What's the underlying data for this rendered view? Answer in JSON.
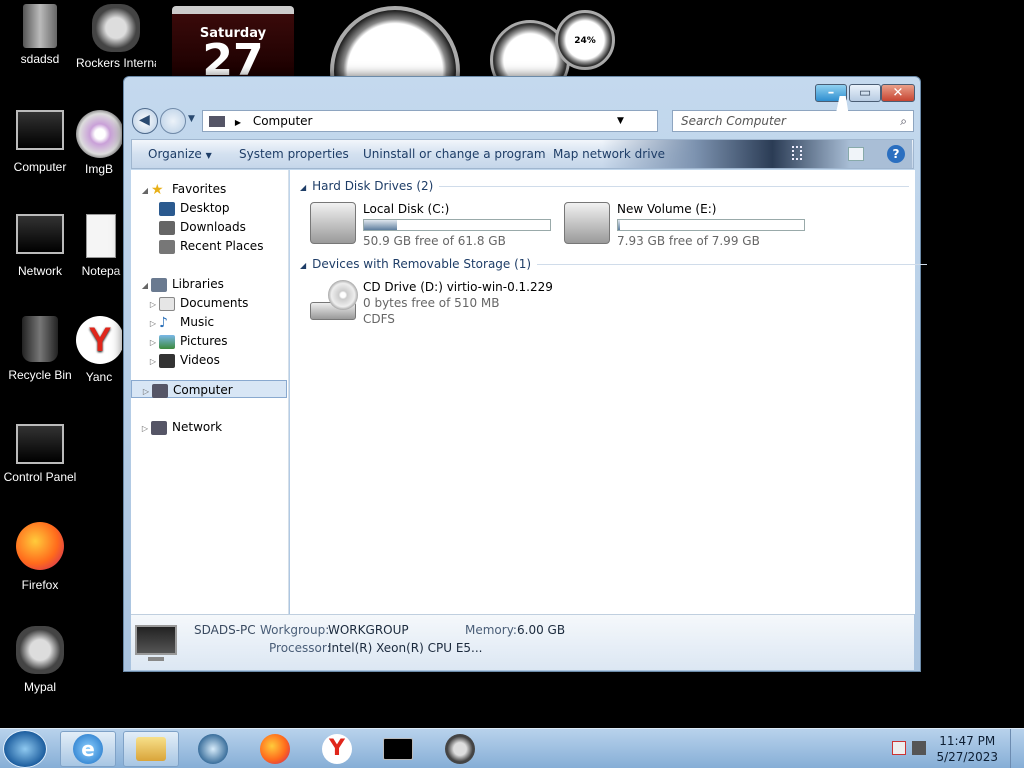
{
  "desktop": {
    "icons": [
      {
        "label": "sdadsd"
      },
      {
        "label": "Rockers Internat"
      },
      {
        "label": "Computer"
      },
      {
        "label": "ImgB"
      },
      {
        "label": "Network"
      },
      {
        "label": "Notepa"
      },
      {
        "label": "Recycle Bin"
      },
      {
        "label": "Yanc"
      },
      {
        "label": "Control Panel"
      },
      {
        "label": "Firefox"
      },
      {
        "label": "Mypal"
      }
    ],
    "gadgets": {
      "calendar_day": "Saturday",
      "calendar_date": "27",
      "meter_percent": "24%"
    }
  },
  "window": {
    "address": {
      "crumb": "Computer"
    },
    "search": {
      "placeholder": "Search Computer"
    },
    "toolbar": {
      "organize": "Organize",
      "system_properties": "System properties",
      "uninstall": "Uninstall or change a program",
      "map_network": "Map network drive",
      "help": "?"
    },
    "nav": {
      "favorites": "Favorites",
      "desktop": "Desktop",
      "downloads": "Downloads",
      "recent_places": "Recent Places",
      "libraries": "Libraries",
      "documents": "Documents",
      "music": "Music",
      "pictures": "Pictures",
      "videos": "Videos",
      "computer": "Computer",
      "network": "Network"
    },
    "groups": {
      "hdd": "Hard Disk Drives (2)",
      "removable": "Devices with Removable Storage (1)"
    },
    "drives": [
      {
        "name": "Local Disk (C:)",
        "free": "50.9 GB free of 61.8 GB",
        "used_fraction": 0.18
      },
      {
        "name": "New Volume (E:)",
        "free": "7.93 GB free of 7.99 GB",
        "used_fraction": 0.01
      },
      {
        "name": "CD Drive (D:) virtio-win-0.1.229",
        "free": "0 bytes free of 510 MB",
        "fs": "CDFS"
      }
    ],
    "details": {
      "pc_name": "SDADS-PC",
      "workgroup_label": "Workgroup:",
      "workgroup": "WORKGROUP",
      "memory_label": "Memory:",
      "memory": "6.00 GB",
      "processor_label": "Processor:",
      "processor": "Intel(R) Xeon(R) CPU E5..."
    }
  },
  "taskbar": {
    "time": "11:47 PM",
    "date": "5/27/2023"
  },
  "colors": {
    "accent": "#2b6fc0",
    "close_button": "#c74532",
    "taskbar": "#9fc0e2"
  }
}
